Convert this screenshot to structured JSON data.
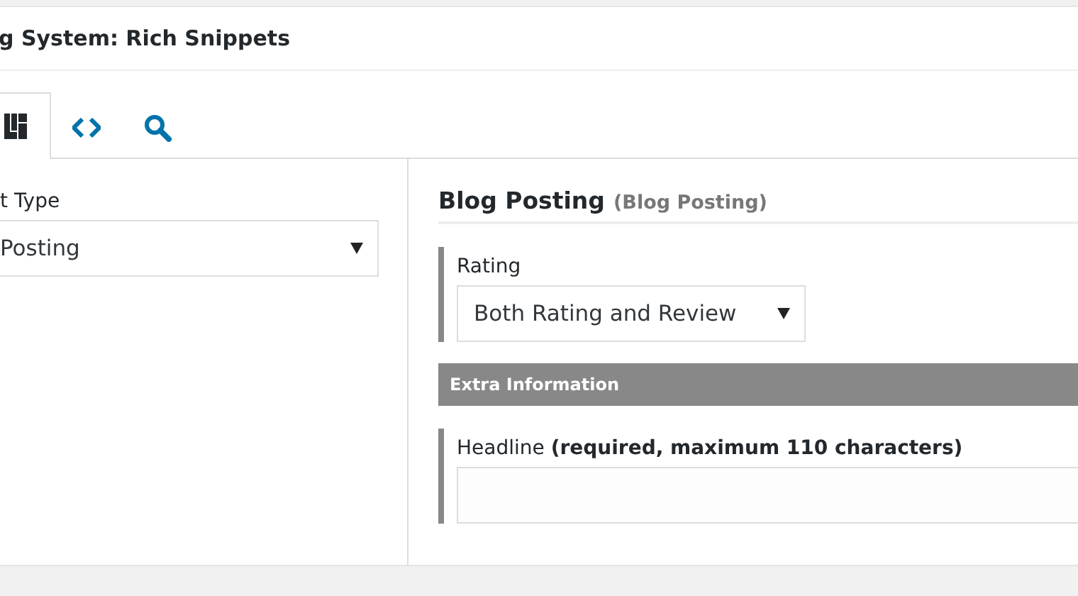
{
  "panel": {
    "title": "g System: Rich Snippets"
  },
  "tabs": [
    {
      "kind": "grid",
      "selected": true
    },
    {
      "kind": "code",
      "selected": false
    },
    {
      "kind": "search",
      "selected": false
    }
  ],
  "left": {
    "label": "t Type",
    "select_value": "Posting"
  },
  "right": {
    "heading": "Blog Posting",
    "subheading": "(Blog Posting)",
    "rating": {
      "label": "Rating",
      "select_value": "Both Rating and Review"
    },
    "section": "Extra Information",
    "headline": {
      "label": "Headline **(required, maximum 110 characters)**"
    }
  }
}
